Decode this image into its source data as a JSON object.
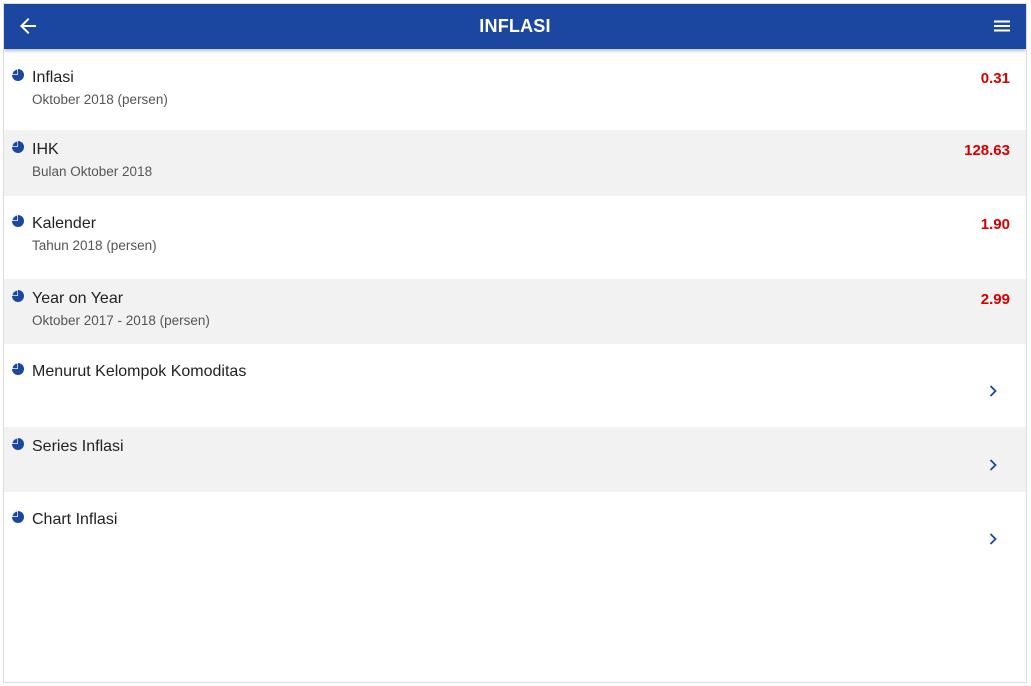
{
  "appbar": {
    "title": "INFLASI",
    "back_icon": "arrow-left-icon",
    "menu_icon": "hamburger-menu-icon",
    "color": "#1c47a0"
  },
  "items": [
    {
      "title": "Inflasi",
      "subtitle": "Oktober 2018 (persen)",
      "value": "0.31",
      "icon": "pie-chart-icon"
    },
    {
      "title": "IHK",
      "subtitle": "Bulan Oktober 2018",
      "value": "128.63",
      "icon": "pie-chart-icon"
    },
    {
      "title": "Kalender",
      "subtitle": "Tahun 2018 (persen)",
      "value": "1.90",
      "icon": "pie-chart-icon"
    },
    {
      "title": "Year on Year",
      "subtitle": "Oktober 2017 - 2018 (persen)",
      "value": "2.99",
      "icon": "pie-chart-icon"
    },
    {
      "title": "Menurut Kelompok Komoditas",
      "icon": "pie-chart-icon",
      "action_icon": "chevron-right-icon"
    },
    {
      "title": "Series Inflasi",
      "icon": "pie-chart-icon",
      "action_icon": "chevron-right-icon"
    },
    {
      "title": "Chart Inflasi",
      "icon": "pie-chart-icon",
      "action_icon": "chevron-right-icon"
    }
  ],
  "colors": {
    "accent": "#1c47a0",
    "value_red": "#d40000",
    "row_alt": "#f2f2f2"
  }
}
